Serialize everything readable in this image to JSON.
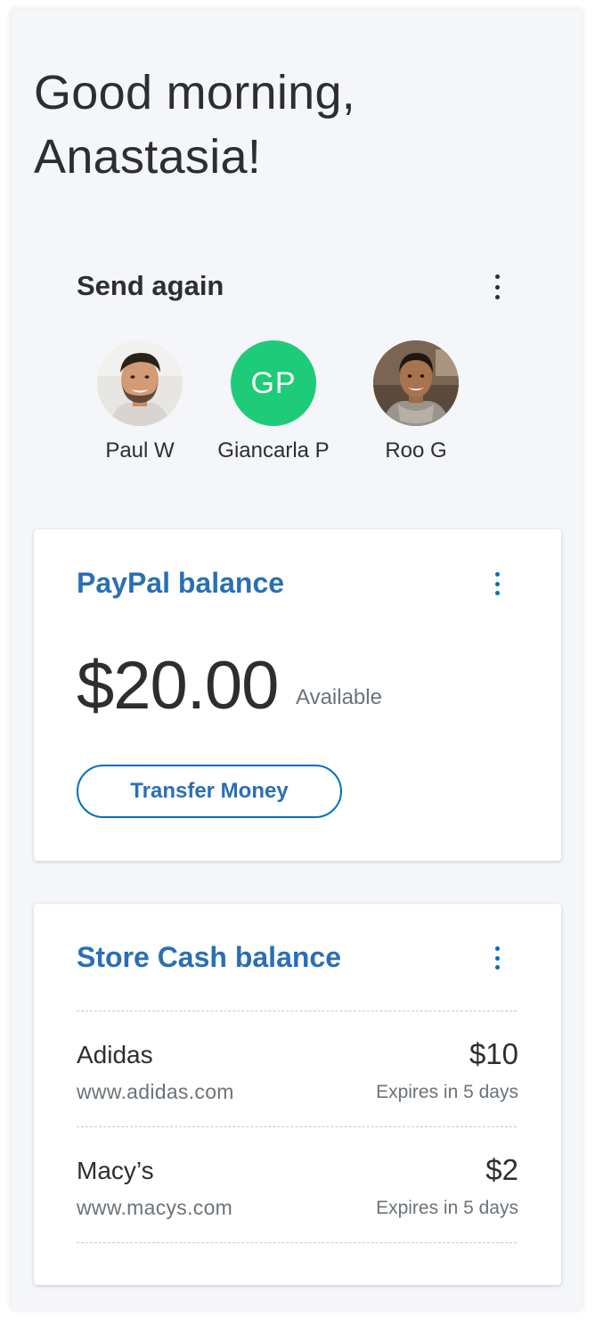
{
  "greeting": {
    "line1": "Good morning,",
    "line2": "Anastasia!"
  },
  "send_again": {
    "title": "Send again",
    "menu_icon": "more-vertical-icon",
    "contacts": [
      {
        "name": "Paul W",
        "avatar": "photo"
      },
      {
        "name": "Giancarla P",
        "initials": "GP",
        "avatar_color": "#1ecb79"
      },
      {
        "name": "Roo G",
        "avatar": "photo"
      }
    ]
  },
  "paypal_balance": {
    "title": "PayPal balance",
    "menu_icon": "more-vertical-icon",
    "amount": "$20.00",
    "available_label": "Available",
    "transfer_button": "Transfer Money"
  },
  "store_cash": {
    "title": "Store Cash balance",
    "menu_icon": "more-vertical-icon",
    "items": [
      {
        "name": "Adidas",
        "url": "www.adidas.com",
        "amount": "$10",
        "expiry": "Expires in 5 days"
      },
      {
        "name": "Macy’s",
        "url": "www.macys.com",
        "amount": "$2",
        "expiry": "Expires in 5 days"
      }
    ]
  },
  "colors": {
    "accent_blue": "#0070ba",
    "title_blue": "#2a6fb5",
    "text_dark": "#2c2e2f",
    "text_muted": "#6c7378",
    "background": "#f4f6fa",
    "initials_green": "#1ecb79"
  }
}
